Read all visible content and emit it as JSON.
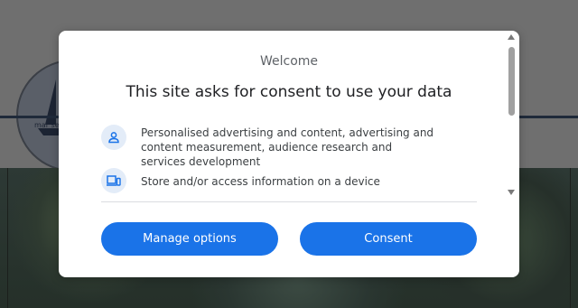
{
  "background": {
    "logo_text": "mar se"
  },
  "dialog": {
    "welcome": "Welcome",
    "headline": "This site asks for consent to use your data",
    "purposes": [
      {
        "icon": "person-icon",
        "label": "Personalised advertising and content, advertising and content measurement, audience research and services development"
      },
      {
        "icon": "devices-icon",
        "label": "Store and/or access information on a device"
      }
    ],
    "buttons": {
      "manage": "Manage options",
      "consent": "Consent"
    }
  },
  "colors": {
    "accent": "#1a73e8",
    "icon_bg": "#e3ecf8",
    "overlay": "#7a7a7a"
  }
}
